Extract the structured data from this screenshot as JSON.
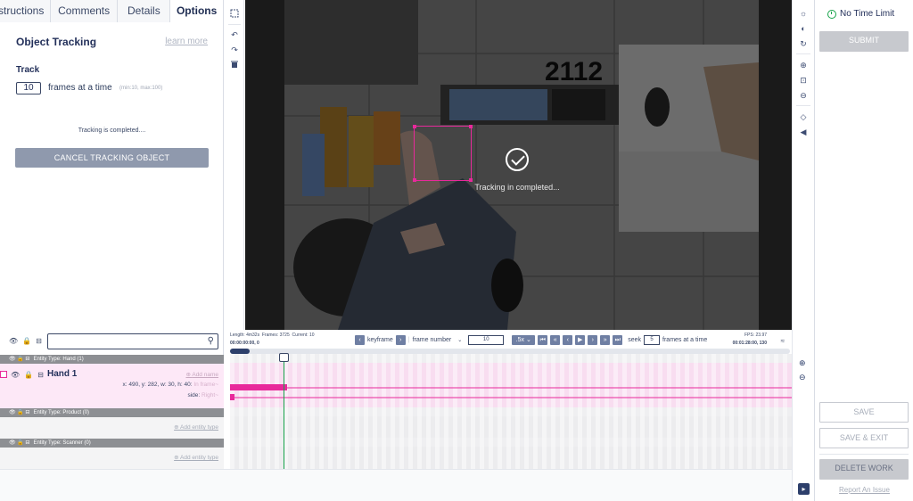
{
  "tabs": [
    {
      "label": "Instructions"
    },
    {
      "label": "Comments"
    },
    {
      "label": "Details"
    },
    {
      "label": "Options"
    }
  ],
  "options": {
    "title": "Object Tracking",
    "learn_more": "learn more",
    "track_label": "Track",
    "frames_value": "10",
    "frames_text": "frames at a time",
    "frames_hint": "(min:10, max:100)",
    "status": "Tracking is completed....",
    "cancel_button": "CANCEL TRACKING OBJECT"
  },
  "canvas": {
    "frame_label": "2112",
    "overlay_text": "Tracking in completed..."
  },
  "right_panel": {
    "timer": "No Time Limit",
    "submit": "SUBMIT",
    "save": "SAVE",
    "save_exit": "SAVE & EXIT",
    "delete": "DELETE WORK",
    "report": "Report An Issue"
  },
  "timeline": {
    "length": "Length: 4m32s",
    "frames": "Frames: 3725",
    "current": "Current: 10",
    "timecode": "00:00:00:00, 0",
    "keyframe_label": "keyframe",
    "frame_number_label": "frame number",
    "frame_number_value": "10",
    "speed": ".5x",
    "seek_label": "seek",
    "seek_value": "5",
    "seek_unit": "frames at a time",
    "fps": "FPS: 23.97",
    "end_timecode": "00:01:28:00, 130"
  },
  "entities": {
    "groups": [
      {
        "header": "Entity Type: Hand (1)"
      },
      {
        "header": "Entity Type: Product (0)"
      },
      {
        "header": "Entity Type: Scanner (0)"
      }
    ],
    "hand": {
      "name": "Hand 1",
      "add_name": "Add name",
      "coords": "x: 490, y: 282, w: 30, h: 40:",
      "in_frame": "In frame",
      "side_label": "side:",
      "side_value": "Right"
    },
    "add_entity_type": "Add entity type"
  },
  "colors": {
    "accent": "#e8299b",
    "nav": "#23305a",
    "timer_green": "#17a34a",
    "cursor_green": "#17a34a"
  }
}
